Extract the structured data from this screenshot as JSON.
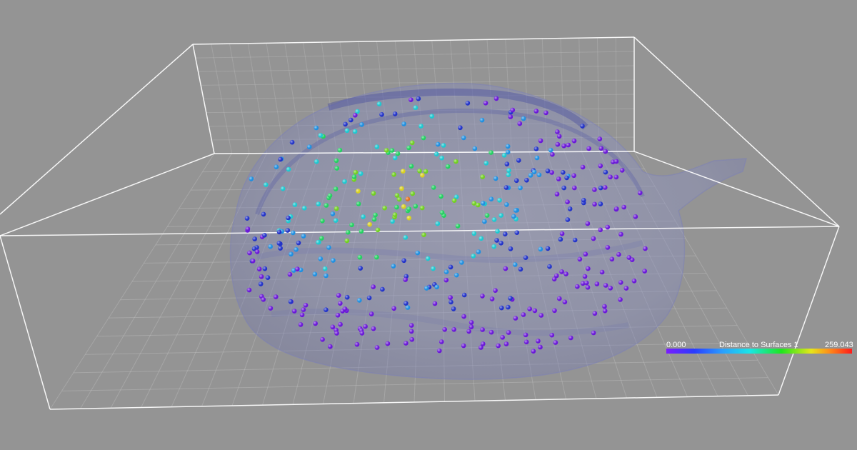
{
  "viewer": {
    "background_color": "#949494",
    "box_color": "#ffffff",
    "grid_color": "#c8c8c8",
    "surface_color": "#8e92b8"
  },
  "colorbar": {
    "min_label": "0.000",
    "title": "Distance to Surfaces 1",
    "max_label": "259.043",
    "gradient": [
      "#7a1cff",
      "#2a3cff",
      "#2a9dff",
      "#19e6e6",
      "#1ee61e",
      "#e6e619",
      "#ff8a19",
      "#ff1a1a"
    ]
  },
  "spots": {
    "colors": [
      "#6a18d8",
      "#2233c8",
      "#1f8fe0",
      "#1cc8d0",
      "#22d060",
      "#70d020",
      "#d8d020",
      "#e07020",
      "#d82020"
    ],
    "count": 420
  }
}
